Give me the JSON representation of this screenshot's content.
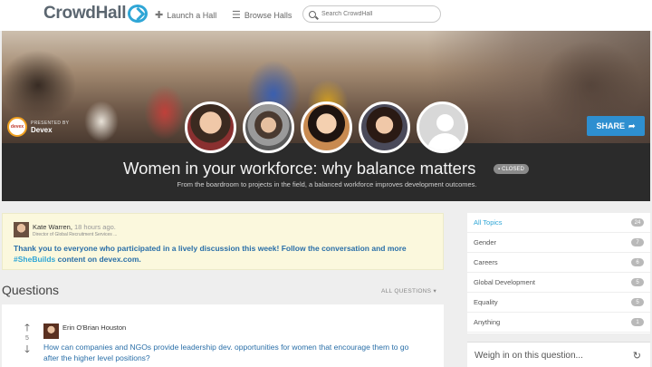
{
  "topbar": {
    "logo": "CrowdHall",
    "launch_label": "Launch a Hall",
    "browse_label": "Browse Halls",
    "search_placeholder": "Search CrowdHall"
  },
  "hero": {
    "presented_label": "PRESENTED BY",
    "presenter": "Devex",
    "presenter_badge": "devex",
    "share_label": "SHARE",
    "title": "Women in your workforce: why balance matters",
    "status": "CLOSED",
    "subtitle": "From the boardroom to projects in the field, a balanced workforce improves development outcomes."
  },
  "post": {
    "author": "Kate Warren,",
    "time": "18 hours ago.",
    "role": "Director of Global Recruitment Services ...",
    "body_main": "Thank you to everyone who participated in a lively discussion this week! Follow the conversation and more",
    "hashtag": "#SheBuilds",
    "body_end": " content on devex.com."
  },
  "questions": {
    "heading": "Questions",
    "filter": "ALL QUESTIONS",
    "items": [
      {
        "author": "Erin O'Brian Houston",
        "votes": "5",
        "text": "How can companies and NGOs provide leadership dev. opportunities for women that encourage them to go after the higher level positions?"
      }
    ]
  },
  "topics": [
    {
      "label": "All Topics",
      "count": "24"
    },
    {
      "label": "Gender",
      "count": "7"
    },
    {
      "label": "Careers",
      "count": "6"
    },
    {
      "label": "Global Development",
      "count": "5"
    },
    {
      "label": "Equality",
      "count": "5"
    },
    {
      "label": "Anything",
      "count": "1"
    }
  ],
  "weigh": {
    "label": "Weigh in on this question..."
  },
  "colors": {
    "accent": "#2fa6d6",
    "share": "#2e8fd0",
    "post_bg": "#fbf8dd",
    "link_text": "#2a6fa8"
  }
}
